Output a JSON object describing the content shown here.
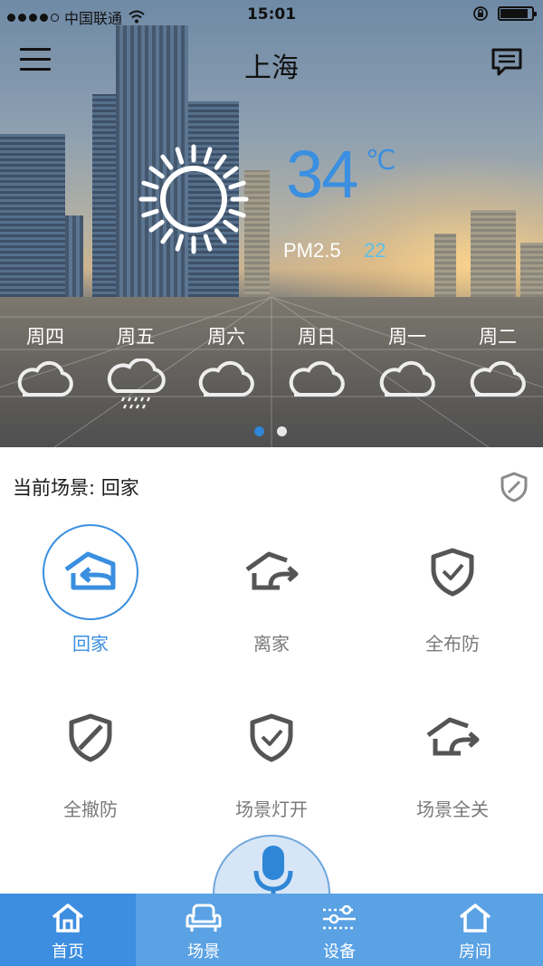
{
  "status_bar": {
    "carrier": "中国联通",
    "time": "15:01"
  },
  "header": {
    "city": "上海",
    "menu_icon": "hamburger-menu-icon",
    "message_icon": "message-icon"
  },
  "weather": {
    "icon": "sun-icon",
    "temperature": "34",
    "unit": "℃",
    "pm_label": "PM2.5",
    "pm_value": "22",
    "forecast": [
      {
        "day": "周四",
        "icon": "cloud-icon"
      },
      {
        "day": "周五",
        "icon": "rain-cloud-icon"
      },
      {
        "day": "周六",
        "icon": "cloud-icon"
      },
      {
        "day": "周日",
        "icon": "cloud-icon"
      },
      {
        "day": "周一",
        "icon": "cloud-icon"
      },
      {
        "day": "周二",
        "icon": "cloud-icon"
      }
    ],
    "pages": 2,
    "active_page": 1
  },
  "scene_panel": {
    "current_label": "当前场景: 回家",
    "shield_icon": "shield-icon",
    "scenes": [
      {
        "label": "回家",
        "icon": "home-return-icon",
        "selected": true
      },
      {
        "label": "离家",
        "icon": "home-leave-icon",
        "selected": false
      },
      {
        "label": "全布防",
        "icon": "shield-check-icon",
        "selected": false
      },
      {
        "label": "全撤防",
        "icon": "shield-slash-icon",
        "selected": false
      },
      {
        "label": "场景灯开",
        "icon": "shield-check-icon",
        "selected": false
      },
      {
        "label": "场景全关",
        "icon": "home-leave-icon",
        "selected": false
      }
    ],
    "mic_icon": "microphone-icon"
  },
  "tab_bar": {
    "tabs": [
      {
        "label": "首页",
        "icon": "home-icon",
        "active": true
      },
      {
        "label": "场景",
        "icon": "sofa-icon",
        "active": false
      },
      {
        "label": "设备",
        "icon": "sliders-icon",
        "active": false
      },
      {
        "label": "房间",
        "icon": "house-outline-icon",
        "active": false
      }
    ]
  },
  "colors": {
    "accent": "#3a8fe0",
    "tab_bar": "#5aa2e4",
    "tab_active": "#3d8ee0",
    "pm_value": "#5cc1e6",
    "icon_gray": "#555555"
  }
}
